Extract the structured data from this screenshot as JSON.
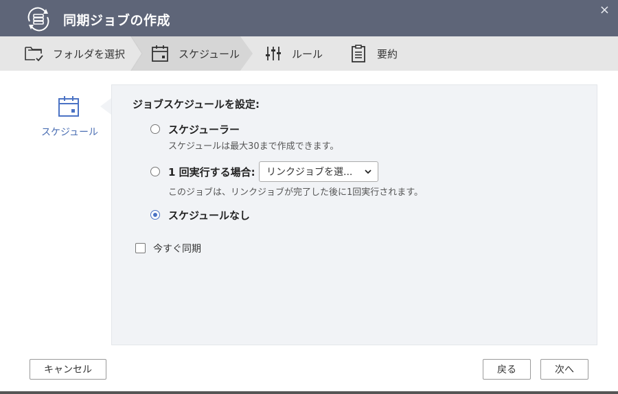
{
  "window": {
    "title": "同期ジョブの作成",
    "close_glyph": "×"
  },
  "wizard": {
    "steps": [
      {
        "label": "フォルダを選択",
        "icon": "folder-check-icon"
      },
      {
        "label": "スケジュール",
        "icon": "calendar-icon",
        "active": true
      },
      {
        "label": "ルール",
        "icon": "sliders-icon"
      },
      {
        "label": "要約",
        "icon": "clipboard-icon"
      }
    ]
  },
  "sidebar": {
    "label": "スケジュール",
    "icon": "calendar-icon"
  },
  "panel": {
    "heading": "ジョブスケジュールを設定:",
    "options": [
      {
        "label": "スケジューラー",
        "desc": "スケジュールは最大30まで作成できます。",
        "checked": false
      },
      {
        "label": "1 回実行する場合:",
        "desc": "このジョブは、リンクジョブが完了した後に1回実行されます。",
        "checked": false,
        "select_value": "リンクジョブを選..."
      },
      {
        "label": "スケジュールなし",
        "checked": true
      }
    ],
    "sync_now": {
      "label": "今すぐ同期",
      "checked": false
    }
  },
  "footer": {
    "cancel": "キャンセル",
    "back": "戻る",
    "next": "次へ"
  },
  "colors": {
    "titlebar": "#5e6578",
    "accent": "#4a72c4",
    "panel_bg": "#f1f3f6"
  }
}
